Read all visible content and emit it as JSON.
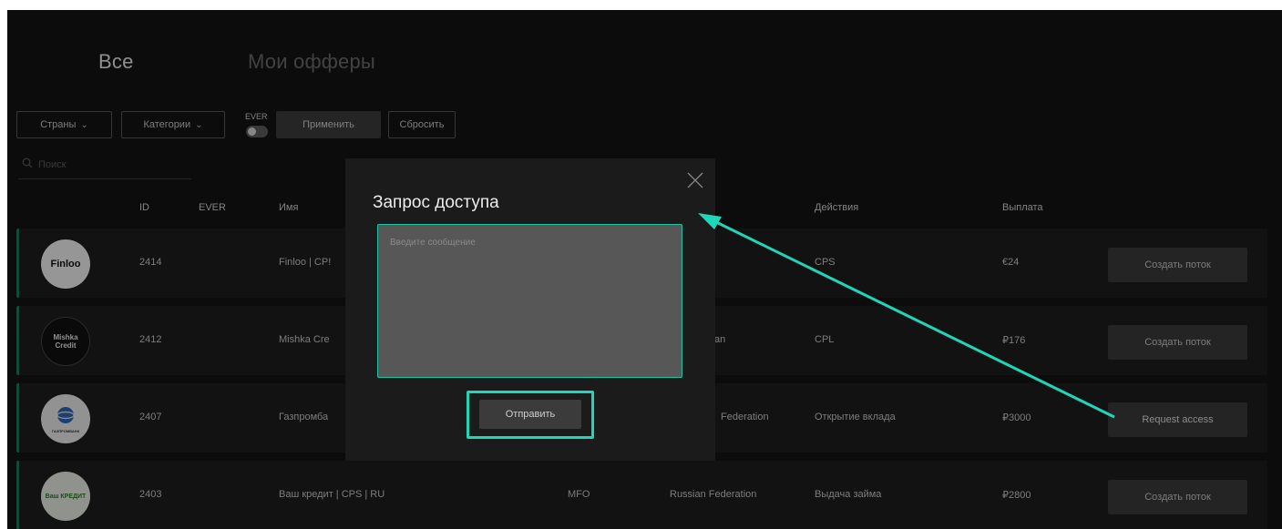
{
  "tabs": [
    {
      "label": "Все",
      "active": true
    },
    {
      "label": "Мои офферы",
      "active": false
    }
  ],
  "filters": {
    "countries_label": "Страны",
    "categories_label": "Категории",
    "ever_label": "EVER",
    "apply_label": "Применить",
    "reset_label": "Сбросить",
    "search_placeholder": "Поиск"
  },
  "table": {
    "columns": [
      "ID",
      "EVER",
      "Имя",
      "Действия",
      "Выплата"
    ],
    "rows": [
      {
        "logo": "Finloo",
        "id": "2414",
        "name": "Finloo | CP!",
        "category": "",
        "geo": "",
        "action": "CPS",
        "payout": "€24",
        "button": "Создать поток"
      },
      {
        "logo": "Mishka Credit",
        "id": "2412",
        "name": "Mishka Cre",
        "category": "",
        "geo": "an",
        "action": "CPL",
        "payout": "₽176",
        "button": "Создать поток"
      },
      {
        "logo": "ГАЗПРОМБАНК",
        "id": "2407",
        "name": "Газпромба",
        "category": "",
        "geo": "Federation",
        "action": "Открытие вклада",
        "payout": "₽3000",
        "button": "Request access"
      },
      {
        "logo": "Ваш КРЕДИТ",
        "id": "2403",
        "name": "Ваш кредит | CPS | RU",
        "category": "MFO",
        "geo": "Russian Federation",
        "action": "Выдача займа",
        "payout": "₽2800",
        "button": "Создать поток"
      }
    ]
  },
  "modal": {
    "title": "Запрос доступа",
    "message_placeholder": "Введите сообщение",
    "send_label": "Отправить"
  },
  "colors": {
    "accent": "#1fd7b8",
    "row_border": "#1f7a5e",
    "background": "#141414"
  }
}
